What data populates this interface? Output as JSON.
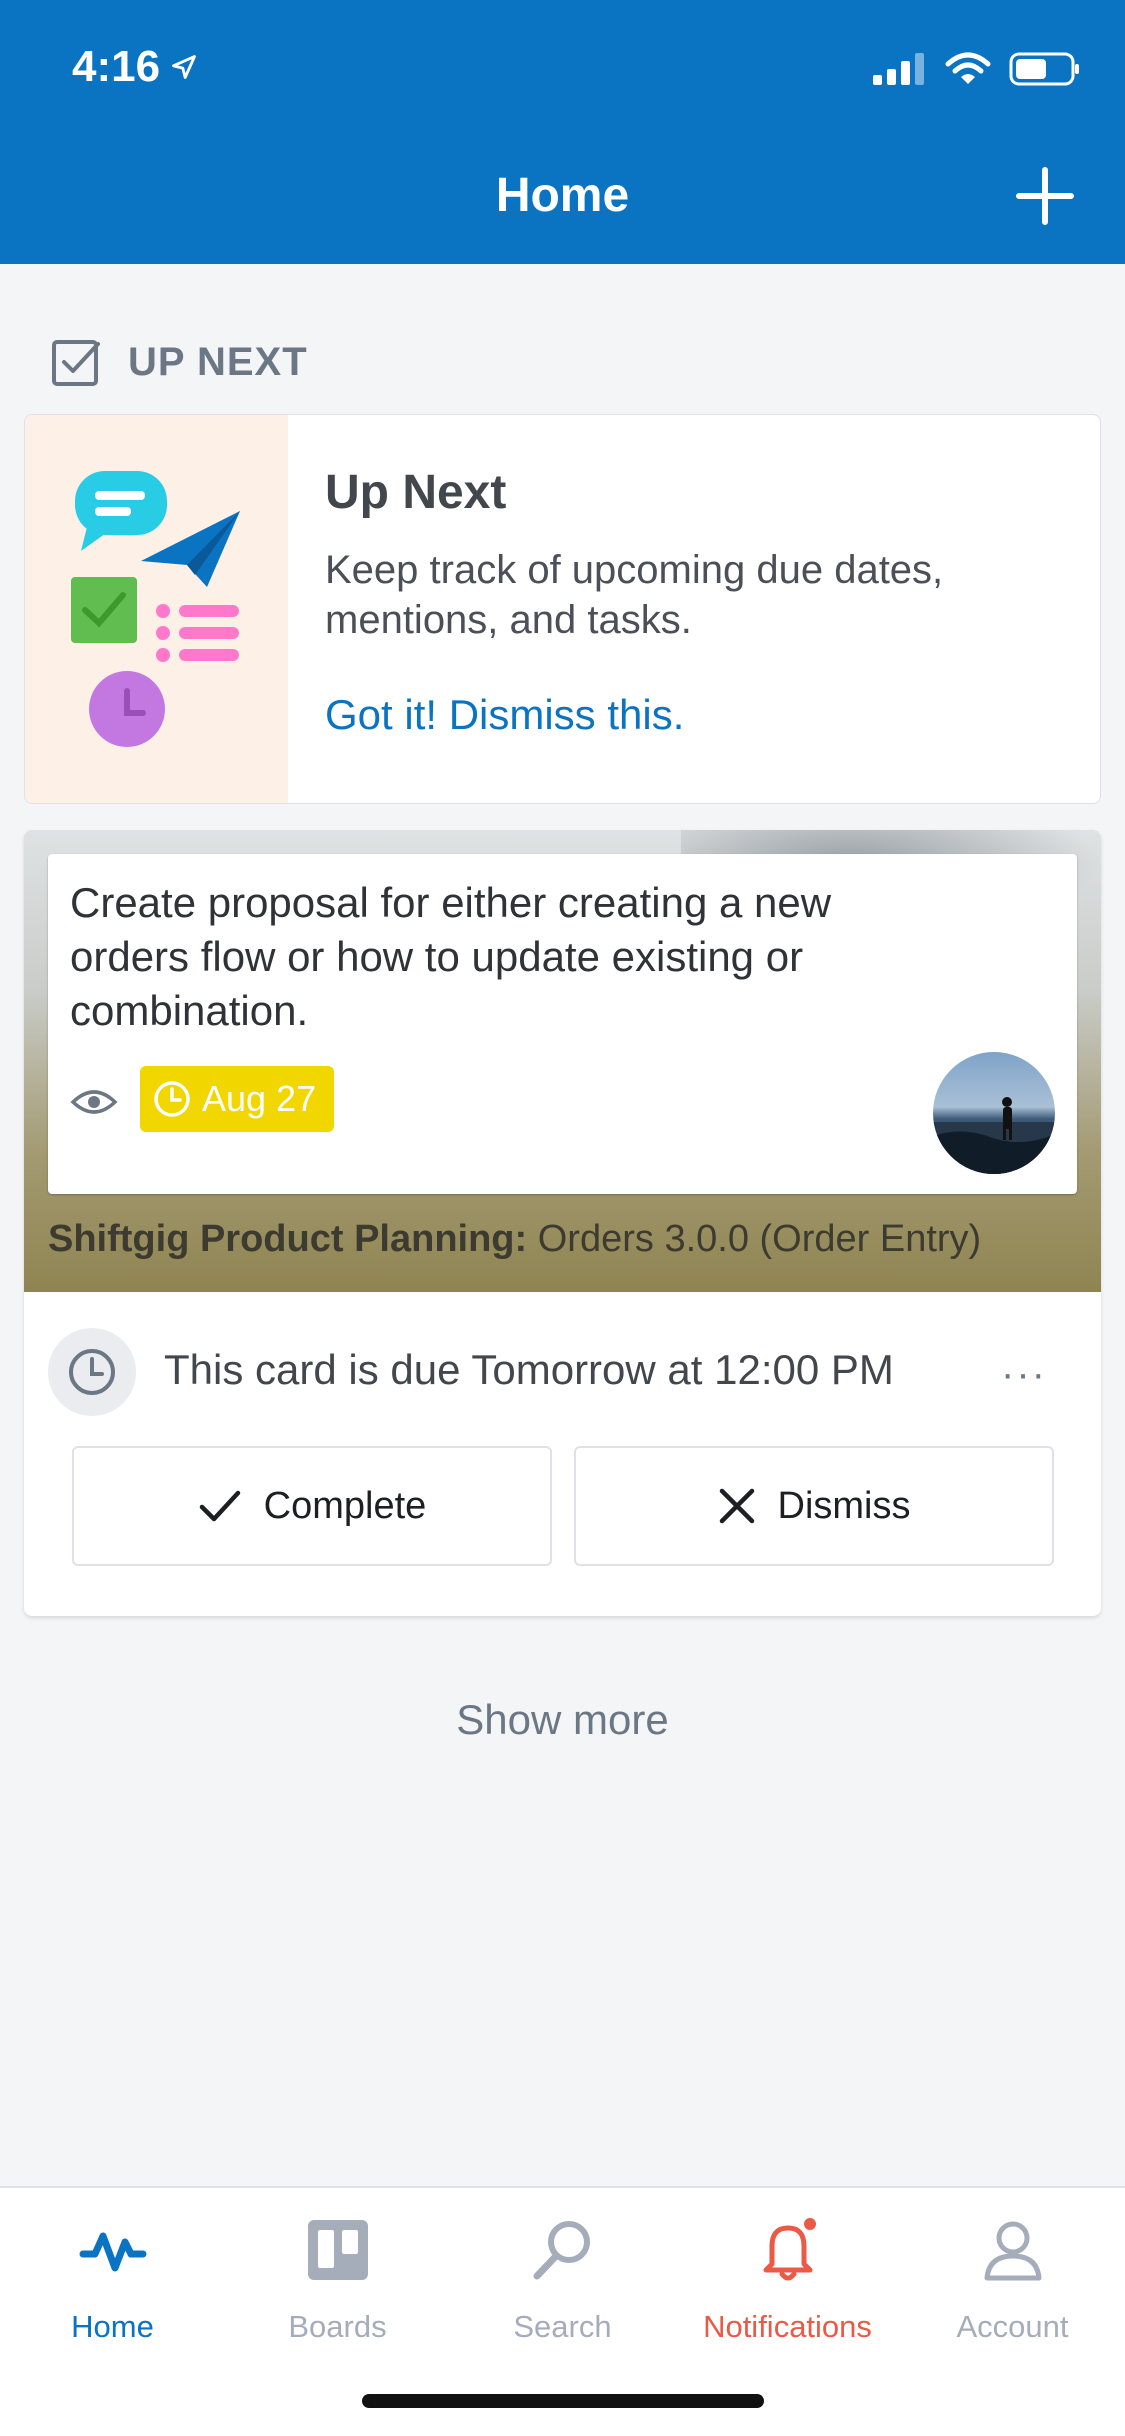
{
  "status_bar": {
    "time": "4:16"
  },
  "header": {
    "title": "Home"
  },
  "section": {
    "title": "UP NEXT"
  },
  "promo": {
    "title": "Up Next",
    "body": "Keep track of upcoming due dates, mentions, and tasks.",
    "link": "Got it! Dismiss this."
  },
  "card": {
    "text": "Create proposal for either creating a new orders flow or how to update existing or combination.",
    "due_badge": "Aug 27",
    "board_name": "Shiftgig Product Planning:",
    "list_name": "Orders 3.0.0 (Order Entry)",
    "due_message": "This card is due Tomorrow at 12:00 PM",
    "more": "···",
    "complete_label": "Complete",
    "dismiss_label": "Dismiss"
  },
  "show_more": "Show more",
  "tabs": [
    {
      "label": "Home",
      "icon": "activity-icon",
      "active": true
    },
    {
      "label": "Boards",
      "icon": "boards-icon"
    },
    {
      "label": "Search",
      "icon": "search-icon"
    },
    {
      "label": "Notifications",
      "icon": "bell-icon",
      "alert": true
    },
    {
      "label": "Account",
      "icon": "account-icon"
    }
  ],
  "colors": {
    "brand_blue": "#0a74c3",
    "due_yellow": "#f2d600",
    "alert_red": "#eb5a46",
    "background": "#f4f5f7"
  }
}
